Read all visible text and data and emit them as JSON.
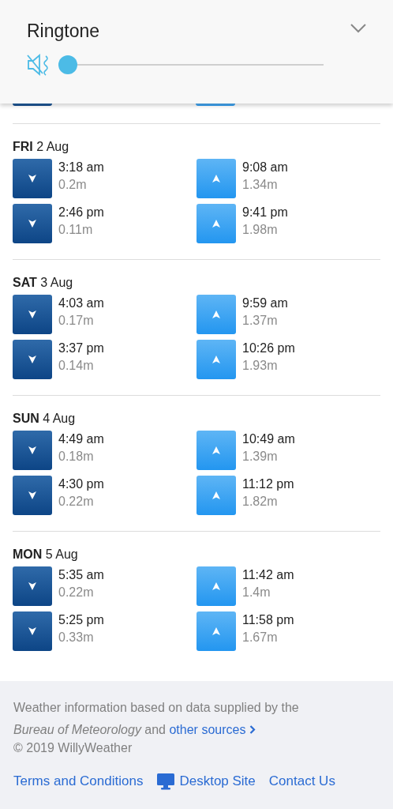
{
  "volume_panel": {
    "title": "Ringtone",
    "muted": true,
    "level": 0
  },
  "days": [
    {
      "weekday": "FRI",
      "date": "2 Aug",
      "tides": [
        {
          "kind": "low",
          "time": "3:18 am",
          "height": "0.2m"
        },
        {
          "kind": "high",
          "time": "9:08 am",
          "height": "1.34m"
        },
        {
          "kind": "low",
          "time": "2:46 pm",
          "height": "0.11m"
        },
        {
          "kind": "high",
          "time": "9:41 pm",
          "height": "1.98m"
        }
      ]
    },
    {
      "weekday": "SAT",
      "date": "3 Aug",
      "tides": [
        {
          "kind": "low",
          "time": "4:03 am",
          "height": "0.17m"
        },
        {
          "kind": "high",
          "time": "9:59 am",
          "height": "1.37m"
        },
        {
          "kind": "low",
          "time": "3:37 pm",
          "height": "0.14m"
        },
        {
          "kind": "high",
          "time": "10:26 pm",
          "height": "1.93m"
        }
      ]
    },
    {
      "weekday": "SUN",
      "date": "4 Aug",
      "tides": [
        {
          "kind": "low",
          "time": "4:49 am",
          "height": "0.18m"
        },
        {
          "kind": "high",
          "time": "10:49 am",
          "height": "1.39m"
        },
        {
          "kind": "low",
          "time": "4:30 pm",
          "height": "0.22m"
        },
        {
          "kind": "high",
          "time": "11:12 pm",
          "height": "1.82m"
        }
      ]
    },
    {
      "weekday": "MON",
      "date": "5 Aug",
      "tides": [
        {
          "kind": "low",
          "time": "5:35 am",
          "height": "0.22m"
        },
        {
          "kind": "high",
          "time": "11:42 am",
          "height": "1.4m"
        },
        {
          "kind": "low",
          "time": "5:25 pm",
          "height": "0.33m"
        },
        {
          "kind": "high",
          "time": "11:58 pm",
          "height": "1.67m"
        }
      ]
    }
  ],
  "footer": {
    "attribution": "Weather information based on data supplied by the *Bureau of Meteorology* and",
    "sources_link": "other sources",
    "copyright": "© 2019 WillyWeather",
    "links": [
      {
        "kind": "text",
        "label": "Terms and Conditions"
      },
      {
        "kind": "desktop",
        "label": "Desktop Site"
      },
      {
        "kind": "text",
        "label": "Contact Us"
      }
    ]
  }
}
